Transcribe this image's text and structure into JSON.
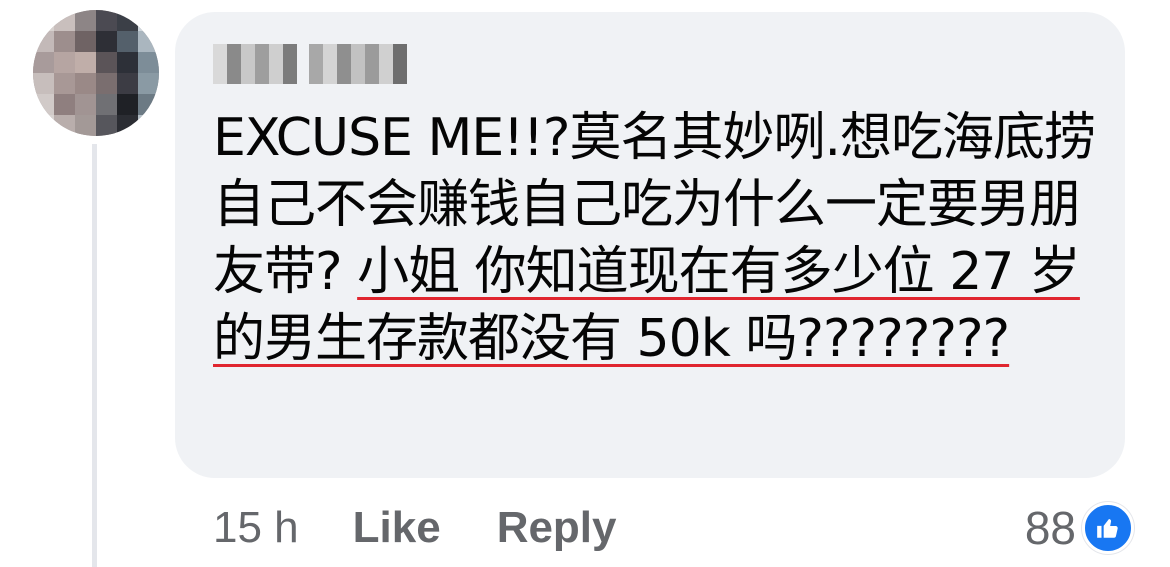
{
  "comment": {
    "author_blurred": true,
    "text": {
      "plain_1": "EXCUSE ME!!?莫名其妙咧.想吃海底捞自己不会赚钱自己吃为什么一定要男朋友带? ",
      "highlighted": "小姐 你知道现在有多少位 27 岁的男生存款都没有 50k 吗????????"
    },
    "highlight_color": "#e0262f"
  },
  "actions": {
    "time": "15 h",
    "like": "Like",
    "reply": "Reply"
  },
  "reactions": {
    "count": "88",
    "icon": "thumbs-up-icon",
    "color": "#1877f2"
  }
}
